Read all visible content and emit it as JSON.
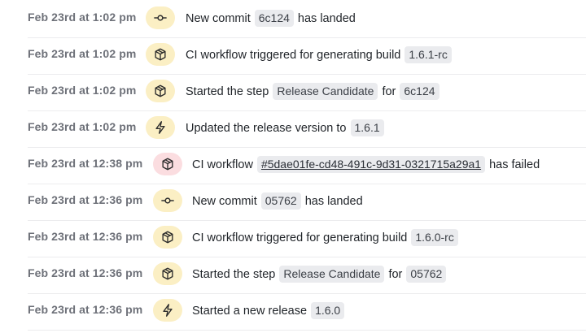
{
  "events": [
    {
      "time": "Feb 23rd at 1:02 pm",
      "icon": "commit-icon",
      "tone": "#fbefc4",
      "before": "New commit",
      "chip": "6c124",
      "after": "has landed"
    },
    {
      "time": "Feb 23rd at 1:02 pm",
      "icon": "package-icon",
      "tone": "#fbefc4",
      "before": "CI workflow triggered for generating build",
      "chip": "1.6.1-rc",
      "after": ""
    },
    {
      "time": "Feb 23rd at 1:02 pm",
      "icon": "package-icon",
      "tone": "#fbefc4",
      "before": "Started the step",
      "chip": "Release Candidate",
      "middle": "for",
      "chip2": "6c124",
      "after": ""
    },
    {
      "time": "Feb 23rd at 1:02 pm",
      "icon": "lightning-icon",
      "tone": "#fbefc4",
      "before": "Updated the release version to",
      "chip": "1.6.1",
      "after": ""
    },
    {
      "time": "Feb 23rd at 12:38 pm",
      "icon": "package-icon",
      "tone": "#fbdde0",
      "before": "CI workflow",
      "chip": "#5dae01fe-cd48-491c-9d31-0321715a29a1",
      "chip_link": true,
      "after": "has failed"
    },
    {
      "time": "Feb 23rd at 12:36 pm",
      "icon": "commit-icon",
      "tone": "#fbefc4",
      "before": "New commit",
      "chip": "05762",
      "after": "has landed"
    },
    {
      "time": "Feb 23rd at 12:36 pm",
      "icon": "package-icon",
      "tone": "#fbefc4",
      "before": "CI workflow triggered for generating build",
      "chip": "1.6.0-rc",
      "after": ""
    },
    {
      "time": "Feb 23rd at 12:36 pm",
      "icon": "package-icon",
      "tone": "#fbefc4",
      "before": "Started the step",
      "chip": "Release Candidate",
      "middle": "for",
      "chip2": "05762",
      "after": ""
    },
    {
      "time": "Feb 23rd at 12:36 pm",
      "icon": "lightning-icon",
      "tone": "#fbefc4",
      "before": "Started a new release",
      "chip": "1.6.0",
      "after": ""
    }
  ]
}
